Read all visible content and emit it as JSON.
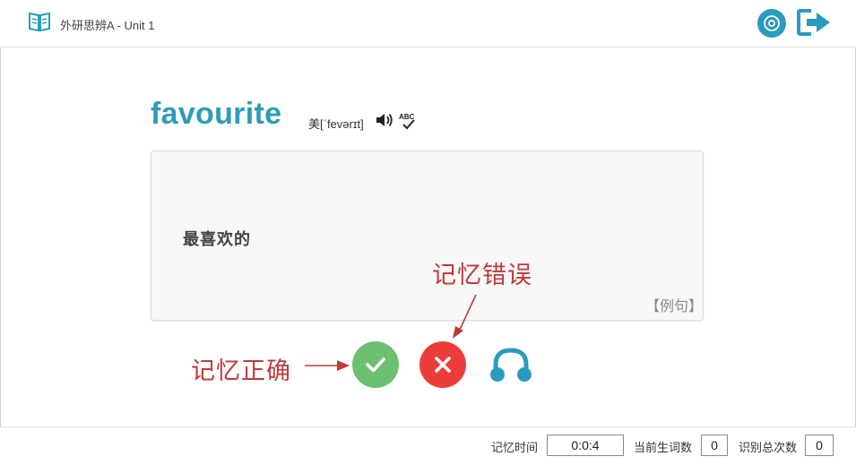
{
  "header": {
    "title": "外研思辨A - Unit 1",
    "logo_icon": "book-icon",
    "record_icon": "disc-icon",
    "exit_icon": "exit-icon",
    "accent_color": "#2a9bbd"
  },
  "word": {
    "text": "favourite",
    "phonetic": "美[ˈfevərɪt]",
    "speaker_icon": "speaker-icon",
    "spell_icon": "spell-check-icon"
  },
  "card": {
    "meaning": "最喜欢的",
    "example_link": "【例句】"
  },
  "annotations": {
    "wrong": "记忆错误",
    "correct": "记忆正确",
    "color": "#c0393b"
  },
  "actions": {
    "correct_icon": "check-icon",
    "wrong_icon": "cross-icon",
    "listen_icon": "headphones-icon",
    "correct_color": "#6cc070",
    "wrong_color": "#ec3d3c"
  },
  "footer": {
    "memory_time_label": "记忆时间",
    "memory_time_value": "0:0:4",
    "current_new_words_label": "当前生词数",
    "current_new_words_value": "0",
    "total_recognized_label": "识别总次数",
    "total_recognized_value": "0"
  }
}
